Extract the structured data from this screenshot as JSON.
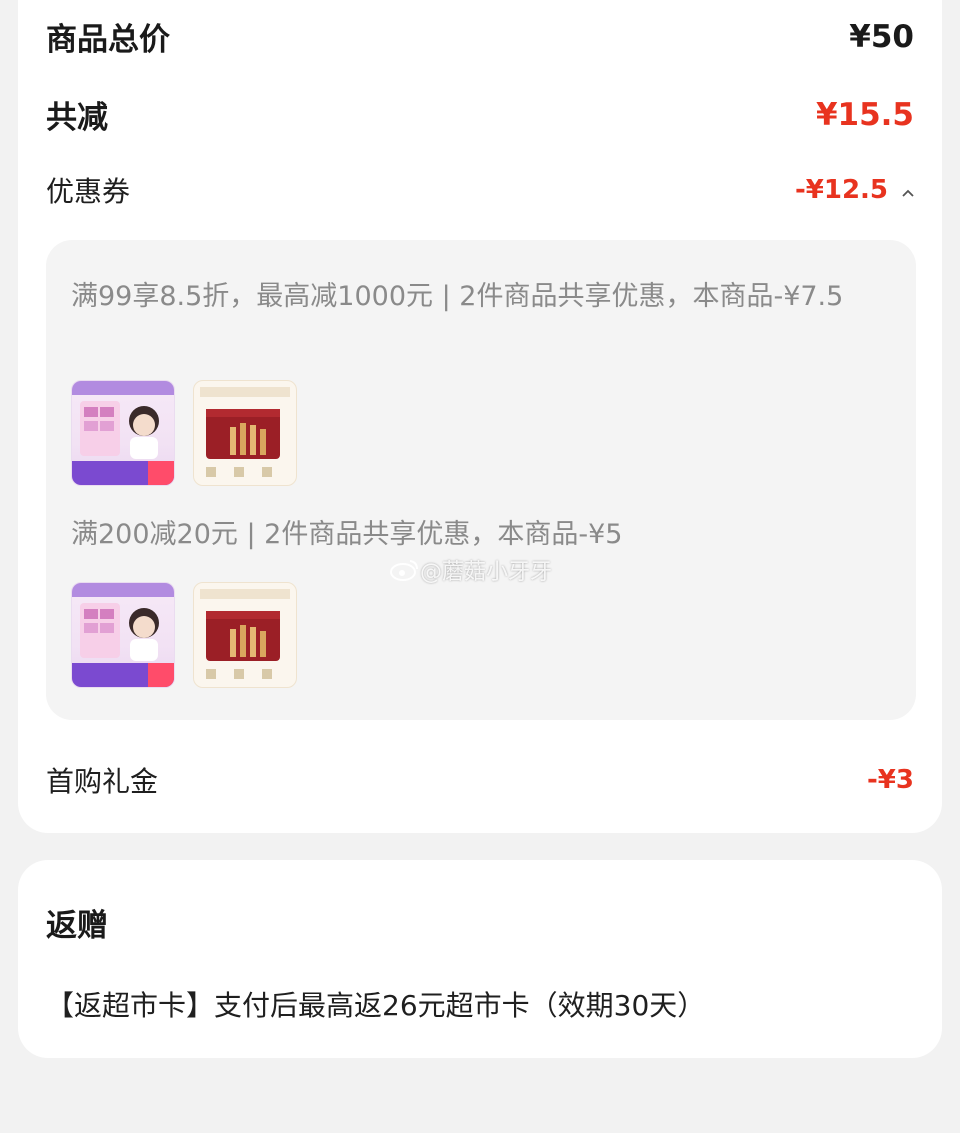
{
  "summary": {
    "total_label": "商品总价",
    "total_value": "¥50",
    "reduce_label": "共减",
    "reduce_value": "¥15.5",
    "coupon_label": "优惠券",
    "coupon_value": "-¥12.5",
    "first_gift_label": "首购礼金",
    "first_gift_value": "-¥3"
  },
  "coupons": [
    {
      "text": "满99享8.5折，最高减1000元 | 2件商品共享优惠，本商品-¥7.5"
    },
    {
      "text": "满200减20元 | 2件商品共享优惠，本商品-¥5"
    }
  ],
  "rebate": {
    "title": "返赠",
    "text": "【返超市卡】支付后最高返26元超市卡（效期30天）"
  },
  "watermark": "@蘑菇小牙牙",
  "colors": {
    "accent_red": "#e8331f",
    "page_bg": "#f2f2f2",
    "card_bg": "#ffffff",
    "coupon_bg": "#f4f4f4"
  }
}
